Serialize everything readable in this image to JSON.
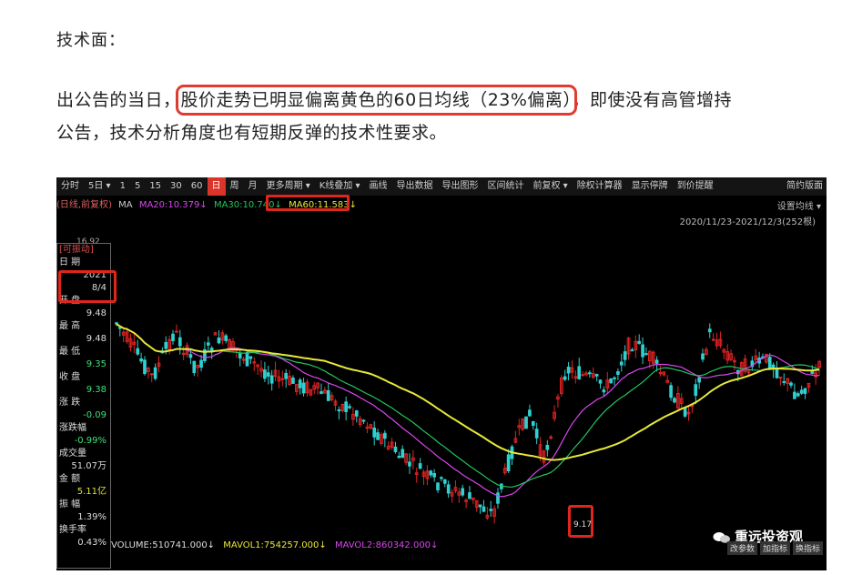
{
  "article": {
    "heading": "技术面：",
    "para_before": "出公告的当日，",
    "para_highlight": "股价走势已明显偏离黄色的60日均线（23%偏离）",
    "para_after": "，即使没有高管增持",
    "para_line2": "公告，技术分析角度也有短期反弹的技术性要求。"
  },
  "toolbar": {
    "items": [
      "分时",
      "5日",
      "1",
      "5",
      "15",
      "30",
      "60",
      "日",
      "周",
      "月",
      "更多周期",
      "K线叠加",
      "画线",
      "导出数据",
      "导出图形",
      "区间统计",
      "前复权",
      "除权计算器",
      "显示停牌",
      "到价提醒"
    ],
    "active": "日",
    "right": "简约版面"
  },
  "chart_info": {
    "label": "(日线,前复权)",
    "ma_label": "MA",
    "ma20": "MA20:10.379↓",
    "ma30": "MA30:10.740↓",
    "ma60": "MA60:11.583↓",
    "settings": "设置均线",
    "range": "2020/11/23-2021/12/3(252根)",
    "top_value": "16.92",
    "low_label": "9.17",
    "colors": {
      "ma20": "#d946ef",
      "ma30": "#22c55e",
      "ma60": "#e8e83a",
      "up": "#e02424",
      "down": "#2fd0d0"
    }
  },
  "info_panel": {
    "title": "[可振动]",
    "date_label": "日  期",
    "date_year": "2021",
    "date_md": "8/4",
    "open_label": "开  盘",
    "open": "9.48",
    "high_label": "最  高",
    "high": "9.48",
    "low_label": "最  低",
    "low": "9.35",
    "close_label": "收  盘",
    "close": "9.38",
    "change_label": "涨  跌",
    "change": "-0.09",
    "pct_label": "涨跌幅",
    "pct": "-0.99%",
    "volume_label": "成交量",
    "volume": "51.07万",
    "amount_label": "金  额",
    "amount": "5.11亿",
    "amp_label": "振  幅",
    "amp": "1.39%",
    "turnover_label": "换手率",
    "turnover": "0.43%"
  },
  "volume_row": {
    "volume": "VOLUME:510741.000↓",
    "mavol1": "MAVOL1:754257.000↓",
    "mavol2": "MAVOL2:860342.000↓"
  },
  "watermark": "重远投资观",
  "bottom_buttons": [
    "改参数",
    "加指标",
    "换指标"
  ]
}
